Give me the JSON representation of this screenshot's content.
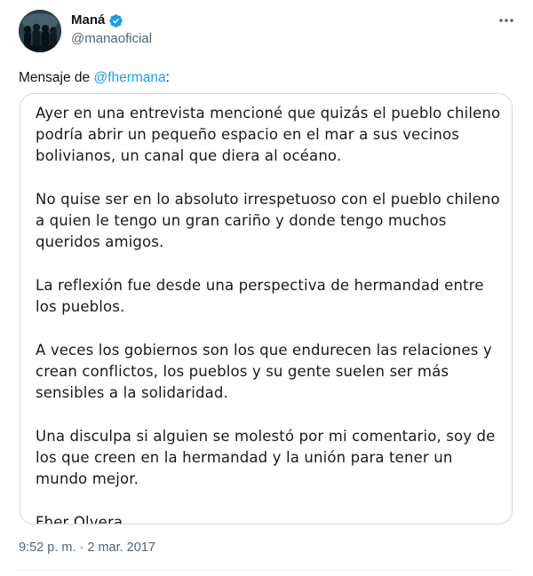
{
  "author": {
    "display_name": "Maná",
    "handle": "@manaoficial",
    "verified": true
  },
  "icons": {
    "verified": "verified-badge-icon",
    "more": "more-options-icon"
  },
  "colors": {
    "link": "#1d9bf0",
    "verified": "#1d9bf0",
    "secondary_text": "#536471"
  },
  "tweet": {
    "intro_prefix": "Mensaje de ",
    "intro_mention": "@fhermana",
    "intro_suffix": ":",
    "message_paragraphs": [
      "Ayer en una entrevista mencioné que quizás el pueblo chileno podría abrir un pequeño espacio en el mar a sus vecinos bolivianos, un canal que diera al océano.",
      "No quise ser en lo absoluto irrespetuoso con el pueblo chileno a quien le tengo un gran cariño y donde tengo muchos queridos amigos.",
      "La reflexión fue desde una perspectiva de hermandad entre los pueblos.",
      "A veces los gobiernos son los que endurecen las relaciones y crean conflictos, los pueblos y su gente suelen ser más sensibles a la solidaridad.",
      "Una disculpa si alguien se molestó por mi comentario, soy de los que creen en la hermandad y la unión para tener un mundo mejor."
    ],
    "signature": "Fher Olvera",
    "timestamp": "9:52 p. m. · 2 mar. 2017"
  }
}
